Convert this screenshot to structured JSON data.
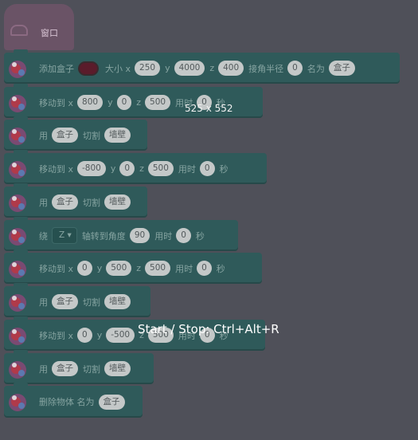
{
  "hat": {
    "label": "窗口"
  },
  "overlay": {
    "dimensions": "525 x 552",
    "shortcut": "Start / Stop: Ctrl+Alt+R"
  },
  "colors": {
    "swatch": "#5a1c2b"
  },
  "blocks": [
    {
      "kind": "add_box",
      "add_label": "添加盒子",
      "size_label": "大小 x",
      "x": "250",
      "y_label": "y",
      "y": "4000",
      "z_label": "z",
      "z": "400",
      "radius_label": "接角半径",
      "radius": "0",
      "name_label": "名为",
      "name": "盒子"
    },
    {
      "kind": "move",
      "label": "移动到 x",
      "x": "800",
      "y_label": "y",
      "y": "0",
      "z_label": "z",
      "z": "500",
      "time_label": "用时",
      "time": "0",
      "unit": "秒"
    },
    {
      "kind": "cut",
      "use_label": "用",
      "target": "盒子",
      "cut_label": "切割",
      "object": "墙壁"
    },
    {
      "kind": "move",
      "label": "移动到 x",
      "x": "-800",
      "y_label": "y",
      "y": "0",
      "z_label": "z",
      "z": "500",
      "time_label": "用时",
      "time": "0",
      "unit": "秒"
    },
    {
      "kind": "cut",
      "use_label": "用",
      "target": "盒子",
      "cut_label": "切割",
      "object": "墙壁"
    },
    {
      "kind": "rotate",
      "around_label": "绕",
      "axis": "Z ▾",
      "rotate_label": "轴转到角度",
      "angle": "90",
      "time_label": "用时",
      "time": "0",
      "unit": "秒"
    },
    {
      "kind": "move",
      "label": "移动到 x",
      "x": "0",
      "y_label": "y",
      "y": "500",
      "z_label": "z",
      "z": "500",
      "time_label": "用时",
      "time": "0",
      "unit": "秒"
    },
    {
      "kind": "cut",
      "use_label": "用",
      "target": "盒子",
      "cut_label": "切割",
      "object": "墙壁"
    },
    {
      "kind": "move",
      "label": "移动到 x",
      "x": "0",
      "y_label": "y",
      "y": "-500",
      "z_label": "z",
      "z": "500",
      "time_label": "用时",
      "time": "0",
      "unit": "秒"
    },
    {
      "kind": "cut",
      "use_label": "用",
      "target": "盒子",
      "cut_label": "切割",
      "object": "墙壁"
    },
    {
      "kind": "delete",
      "label": "删除物体 名为",
      "name": "盒子"
    }
  ]
}
